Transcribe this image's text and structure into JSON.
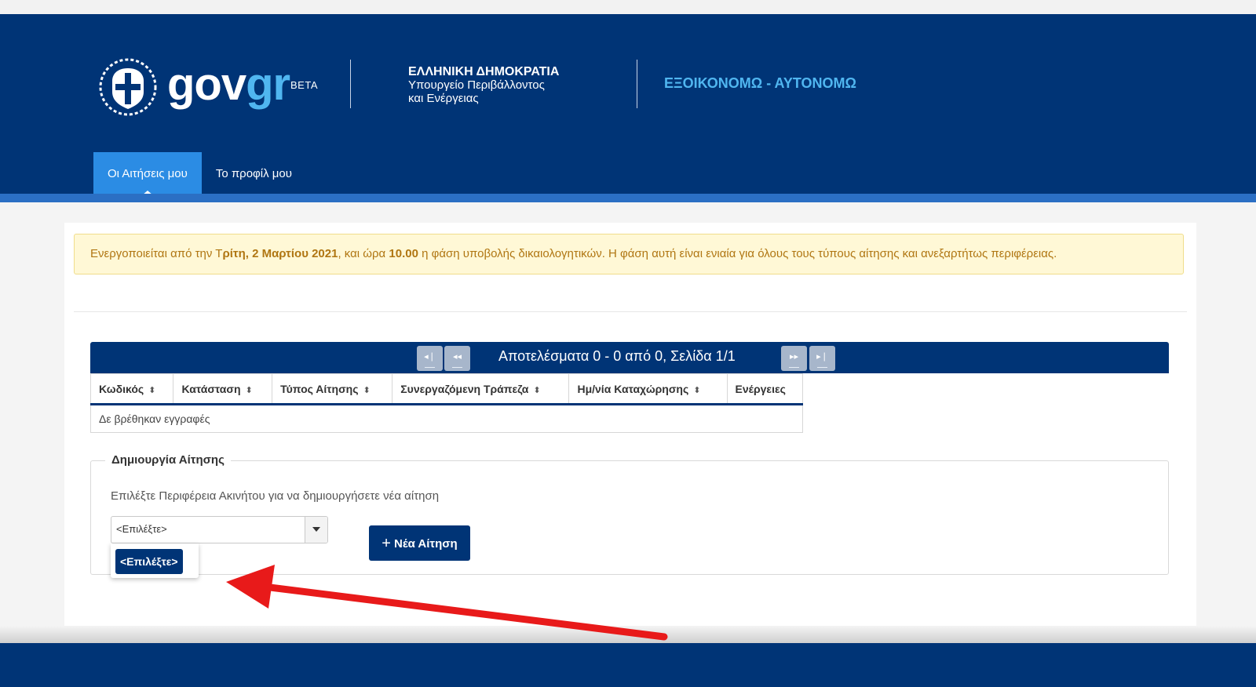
{
  "header": {
    "logo_gov": "gov",
    "logo_gr": "gr",
    "logo_beta": "BETA",
    "org_line1": "ΕΛΛΗΝΙΚΗ ΔΗΜΟΚΡΑΤΙΑ",
    "org_line2": "Υπουργείο Περιβάλλοντος",
    "org_line3": "και Ενέργειας",
    "app_title": "ΕΞΟΙΚΟΝΟΜΩ - ΑΥΤΟΝΟΜΩ",
    "tabs": [
      {
        "label": "Οι Αιτήσεις μου",
        "active": true
      },
      {
        "label": "Το προφίλ μου",
        "active": false
      }
    ]
  },
  "alert": {
    "text_start": "Ενεργοποιείται από την Τ",
    "bold_date": "ρίτη, 2 Μαρτίου 2021",
    "text_mid": ", και ώρα ",
    "bold_time": "10.00",
    "text_end": " η φάση υποβολής δικαιολογητικών. Η φάση αυτή είναι ενιαία για όλους τους τύπους αίτησης και ανεξαρτήτως περιφέρειας."
  },
  "results": {
    "summary": "Αποτελέσματα 0 - 0 από 0, Σελίδα 1/1",
    "first_icon": "first-page-icon",
    "prev_icon": "prev-page-icon",
    "next_icon": "next-page-icon",
    "last_icon": "last-page-icon"
  },
  "table": {
    "columns": [
      "Κωδικός",
      "Κατάσταση",
      "Τύπος Αίτησης",
      "Συνεργαζόμενη Τράπεζα",
      "Ημ/νία Καταχώρησης",
      "Ενέργειες"
    ],
    "empty_message": "Δε βρέθηκαν εγγραφές"
  },
  "create": {
    "legend": "Δημιουργία Αίτησης",
    "hint": "Επιλέξτε Περιφέρεια Ακινήτου για να δημιουργήσετε νέα αίτηση",
    "select_value": "<Επιλέξτε>",
    "dropdown_option": "<Επιλέξτε>",
    "new_button": "Νέα Αίτηση"
  },
  "colors": {
    "header_bg": "#003476",
    "accent": "#2b8ce4",
    "logo_light_blue": "#50b6f0",
    "alert_bg": "#fff8d6",
    "alert_text": "#b07612",
    "annotation_arrow": "#e81a1a"
  }
}
